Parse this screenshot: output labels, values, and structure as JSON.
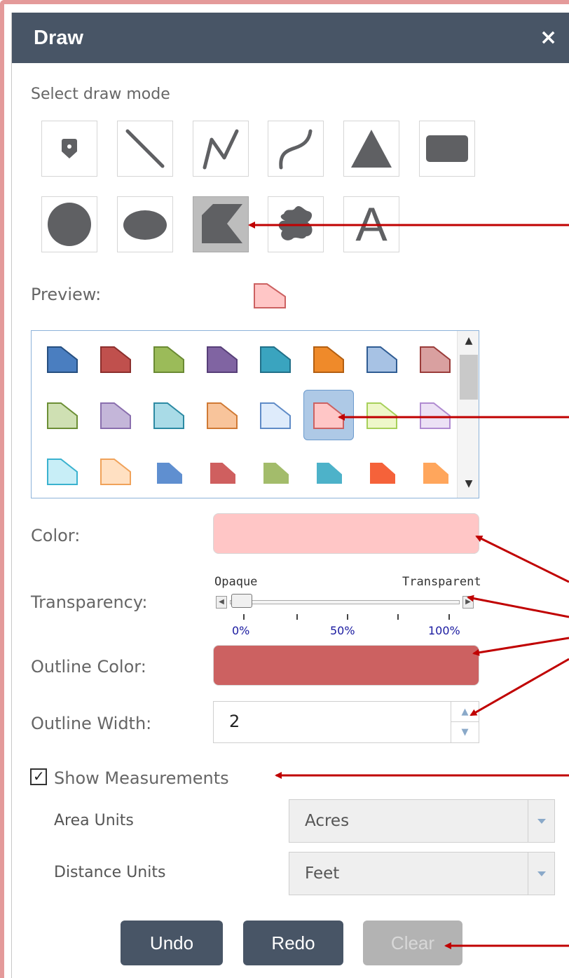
{
  "dialog": {
    "title": "Draw",
    "close_label": "×"
  },
  "draw_mode": {
    "label": "Select draw mode",
    "tools": [
      {
        "name": "point-tool",
        "icon": "map-pin-icon",
        "selected": false
      },
      {
        "name": "line-tool",
        "icon": "line-icon",
        "selected": false
      },
      {
        "name": "polyline-tool",
        "icon": "polyline-icon",
        "selected": false
      },
      {
        "name": "freehand-polyline-tool",
        "icon": "freehand-line-icon",
        "selected": false
      },
      {
        "name": "triangle-tool",
        "icon": "triangle-icon",
        "selected": false
      },
      {
        "name": "rectangle-tool",
        "icon": "rectangle-icon",
        "selected": false
      },
      {
        "name": "circle-tool",
        "icon": "circle-icon",
        "selected": false
      },
      {
        "name": "ellipse-tool",
        "icon": "ellipse-icon",
        "selected": false
      },
      {
        "name": "polygon-tool",
        "icon": "polygon-icon",
        "selected": true
      },
      {
        "name": "freehand-polygon-tool",
        "icon": "freehand-polygon-icon",
        "selected": false
      },
      {
        "name": "text-tool",
        "icon": "text-icon",
        "selected": false
      }
    ],
    "text_tool_glyph": "A"
  },
  "preview": {
    "label": "Preview:",
    "fill": "#ffc6c6",
    "outline": "#cc6161"
  },
  "symbols": {
    "selected_index": 13,
    "items": [
      {
        "fill": "#4a7ec0",
        "outline": "#264f80"
      },
      {
        "fill": "#c0504d",
        "outline": "#8c2f2d"
      },
      {
        "fill": "#9bbb59",
        "outline": "#6a8a33"
      },
      {
        "fill": "#8064a2",
        "outline": "#573f78"
      },
      {
        "fill": "#3aa4bf",
        "outline": "#217089"
      },
      {
        "fill": "#ef8a2a",
        "outline": "#b35f12"
      },
      {
        "fill": "#a7c2e4",
        "outline": "#2f5c93"
      },
      {
        "fill": "#d9a0a0",
        "outline": "#9a3c3a"
      },
      {
        "fill": "#cfe0b3",
        "outline": "#6c8f35"
      },
      {
        "fill": "#c4b6d9",
        "outline": "#8a6fae"
      },
      {
        "fill": "#a9dbe7",
        "outline": "#2c8aa3"
      },
      {
        "fill": "#f8c49b",
        "outline": "#d07a35"
      },
      {
        "fill": "#deebfb",
        "outline": "#5f8bc7"
      },
      {
        "fill": "#ffc6c6",
        "outline": "#cc6161"
      },
      {
        "fill": "#eef7c9",
        "outline": "#a7d05a"
      },
      {
        "fill": "#ece1f5",
        "outline": "#b08bd1"
      },
      {
        "fill": "#c8eef7",
        "outline": "#3ab2cf"
      },
      {
        "fill": "#ffe0c2",
        "outline": "#f0a25a"
      },
      {
        "fill": "#5f8fd0",
        "outline": "#5f8fd0"
      },
      {
        "fill": "#cf5f5f",
        "outline": "#cf5f5f"
      },
      {
        "fill": "#a3bc6b",
        "outline": "#a3bc6b"
      },
      {
        "fill": "#4db2c9",
        "outline": "#4db2c9"
      },
      {
        "fill": "#f5623a",
        "outline": "#f5623a"
      },
      {
        "fill": "#ffa65c",
        "outline": "#ffa65c"
      }
    ]
  },
  "color": {
    "label": "Color:",
    "value": "#ffc6c6"
  },
  "transparency": {
    "label": "Transparency:",
    "left_label": "Opaque",
    "right_label": "Transparent",
    "ticks": [
      "0%",
      "50%",
      "100%"
    ],
    "value": 0
  },
  "outline_color": {
    "label": "Outline Color:",
    "value": "#cc6161"
  },
  "outline_width": {
    "label": "Outline Width:",
    "value": "2"
  },
  "measurements": {
    "label": "Show Measurements",
    "checked": true,
    "check_glyph": "✓",
    "area_units_label": "Area Units",
    "area_units_value": "Acres",
    "distance_units_label": "Distance Units",
    "distance_units_value": "Feet"
  },
  "buttons": {
    "undo": "Undo",
    "redo": "Redo",
    "clear": "Clear"
  },
  "annotation_color": "#c00000"
}
